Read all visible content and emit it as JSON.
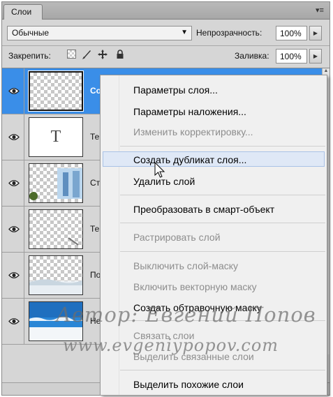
{
  "panel": {
    "tab_label": "Слои",
    "menu_icon": "panel-menu-icon"
  },
  "blend": {
    "mode": "Обычные",
    "opacity_label": "Непрозрачность:",
    "opacity_value": "100%"
  },
  "lock": {
    "label": "Закрепить:",
    "icons": [
      "lock-transparent-pixels-icon",
      "lock-image-pixels-icon",
      "lock-position-icon",
      "lock-all-icon"
    ],
    "fill_label": "Заливка:",
    "fill_value": "100%"
  },
  "layers": [
    {
      "name": "Со",
      "selected": true,
      "thumb": "transparent"
    },
    {
      "name": "Те",
      "selected": false,
      "thumb": "text",
      "thumb_glyph": "T"
    },
    {
      "name": "Ст",
      "selected": false,
      "thumb": "image-partial"
    },
    {
      "name": "Те",
      "selected": false,
      "thumb": "transparent-stroke"
    },
    {
      "name": "По",
      "selected": false,
      "thumb": "snow"
    },
    {
      "name": "Не",
      "selected": false,
      "thumb": "sea"
    }
  ],
  "context_menu": {
    "items": [
      {
        "label": "Параметры слоя...",
        "disabled": false
      },
      {
        "label": "Параметры наложения...",
        "disabled": false
      },
      {
        "label": "Изменить корректировку...",
        "disabled": true
      },
      {
        "label": "Создать дубликат слоя...",
        "disabled": false,
        "hover": true
      },
      {
        "label": "Удалить слой",
        "disabled": false
      },
      {
        "label": "Преобразовать в смарт-объект",
        "disabled": false
      },
      {
        "label": "Растрировать слой",
        "disabled": true
      },
      {
        "label": "Выключить слой-маску",
        "disabled": true
      },
      {
        "label": "Включить векторную маску",
        "disabled": true
      },
      {
        "label": "Создать обтравочную маску",
        "disabled": false
      },
      {
        "label": "Связать слои",
        "disabled": true
      },
      {
        "label": "Выделить связанные слои",
        "disabled": true
      },
      {
        "label": "Выделить похожие слои",
        "disabled": false
      }
    ]
  },
  "watermark": {
    "author": "Автор:  Евгений  Попов",
    "url": "www.evgeniypopov.com"
  },
  "colors": {
    "selection": "#3a8ee8",
    "panel_bg": "#d6d6d6",
    "menu_bg": "#f0f0f0",
    "disabled_text": "#8d8d8d"
  }
}
